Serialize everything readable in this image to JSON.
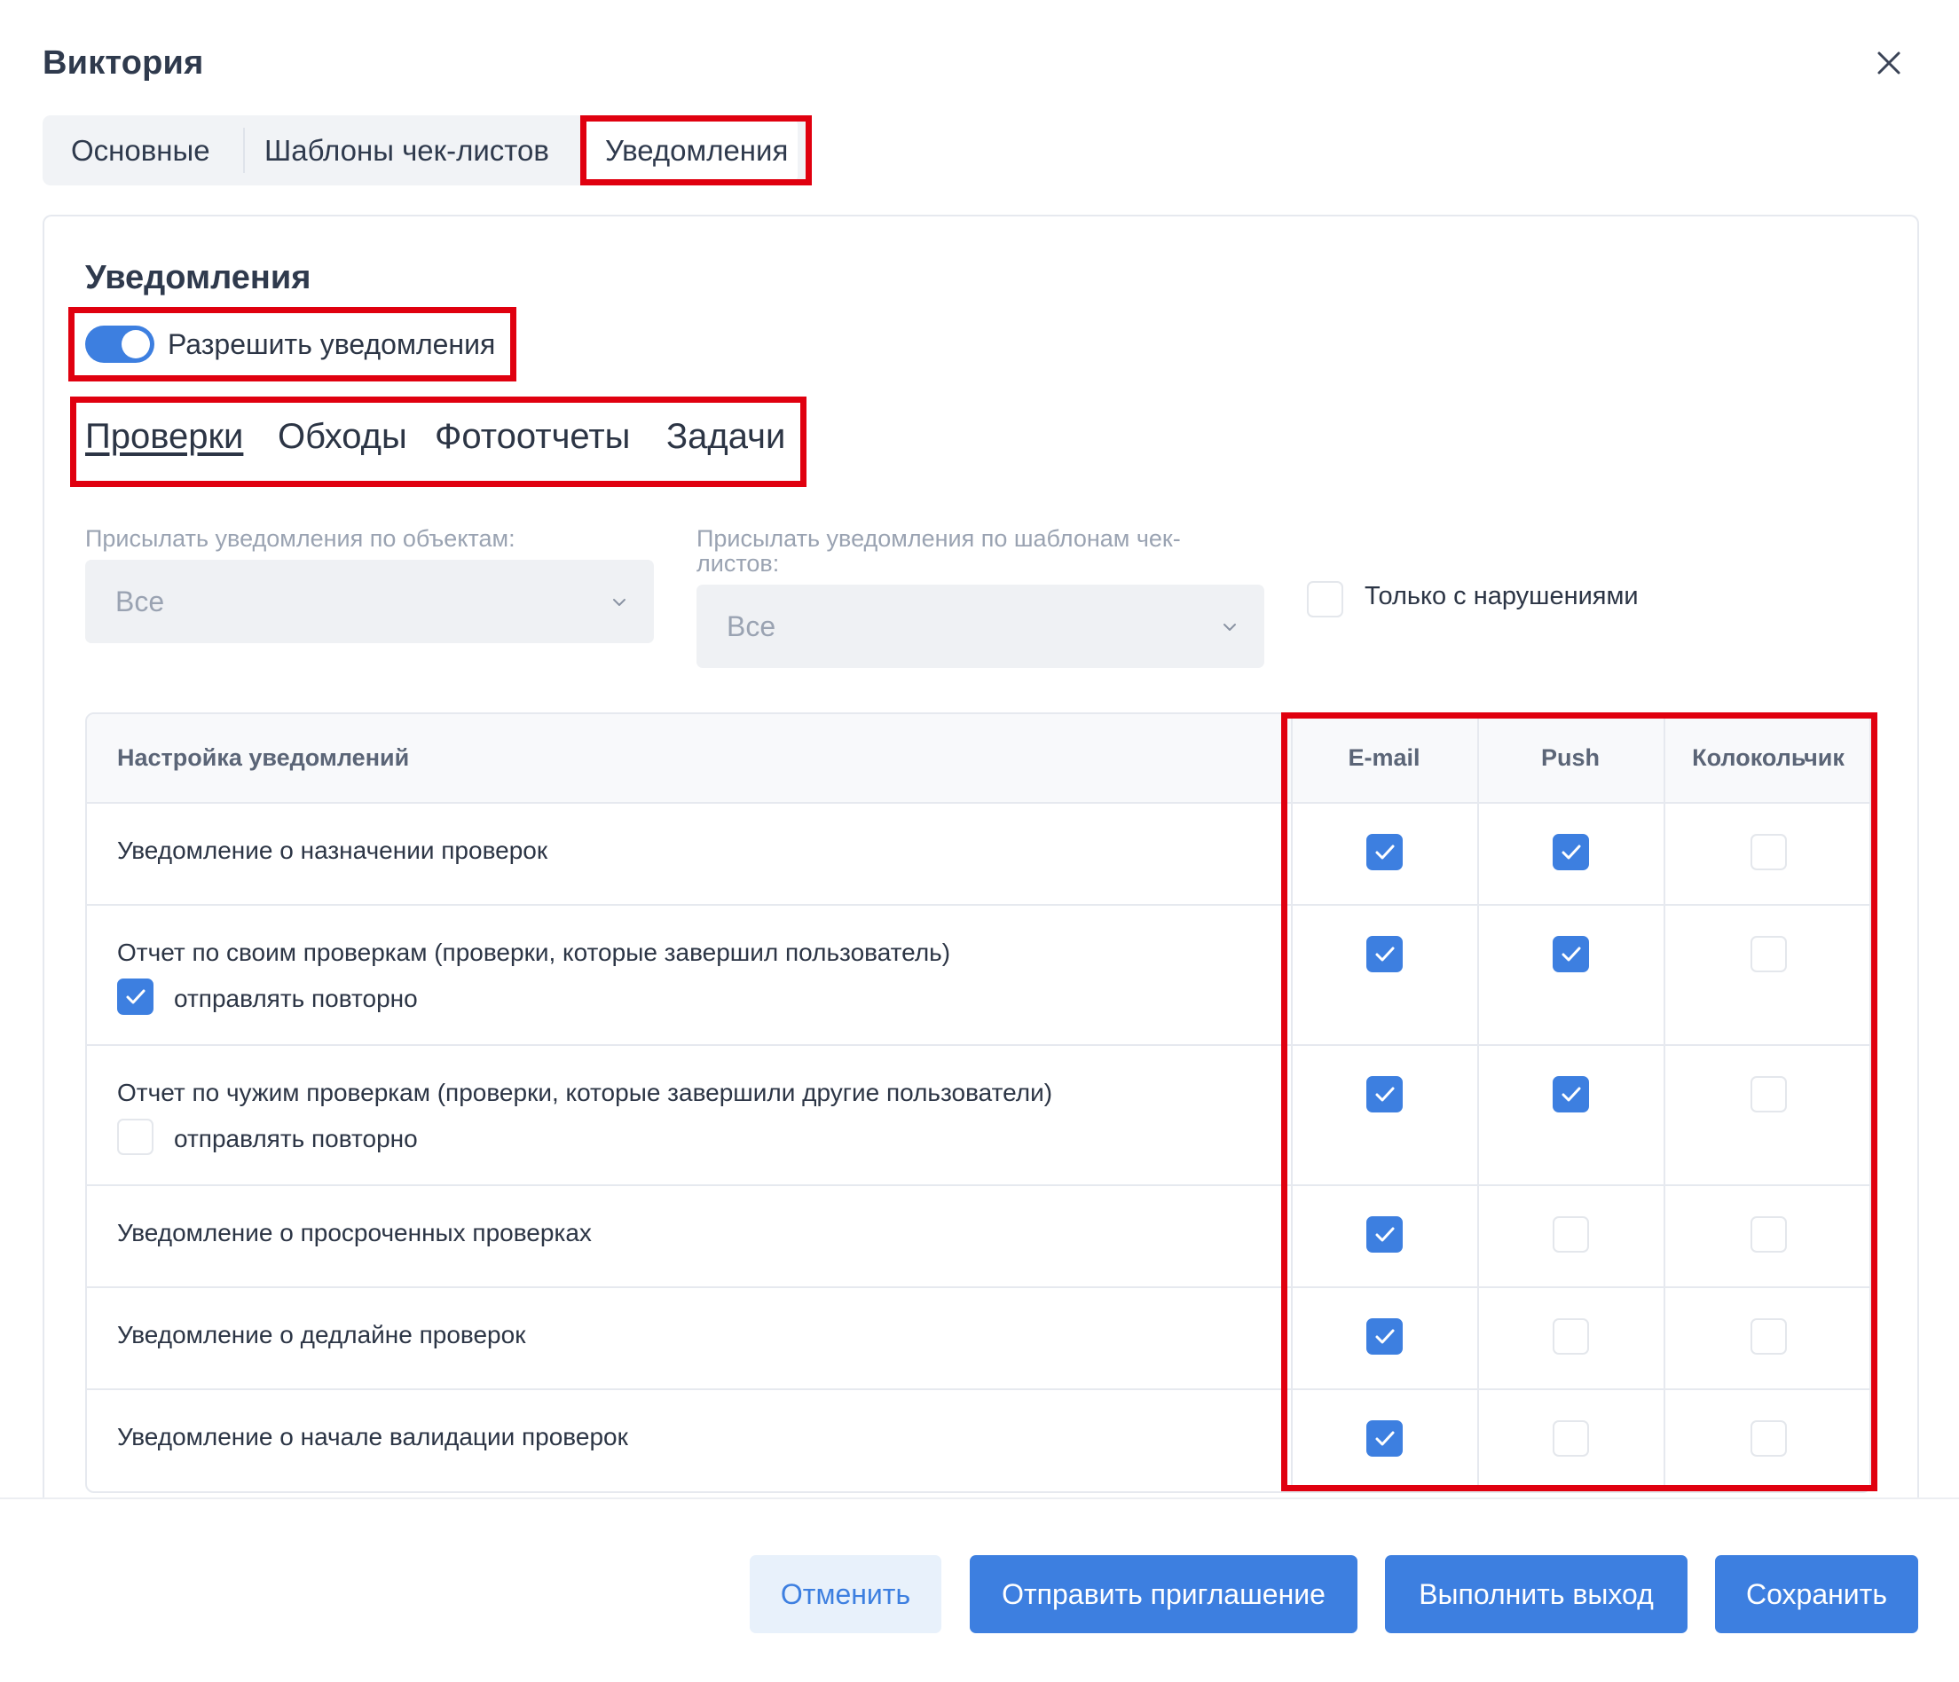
{
  "dialog": {
    "title": "Виктория",
    "close_icon": "close-icon"
  },
  "tabs": [
    {
      "label": "Основные",
      "active": false
    },
    {
      "label": "Шаблоны чек-листов",
      "active": false
    },
    {
      "label": "Уведомления",
      "active": true
    }
  ],
  "section": {
    "title": "Уведомления",
    "toggle": {
      "label": "Разрешить уведомления",
      "on": true
    }
  },
  "subtabs": [
    {
      "label": "Проверки",
      "active": true
    },
    {
      "label": "Обходы",
      "active": false
    },
    {
      "label": "Фотоотчеты",
      "active": false
    },
    {
      "label": "Задачи",
      "active": false
    }
  ],
  "filters": {
    "objects": {
      "label": "Присылать уведомления по объектам:",
      "value": "Все"
    },
    "templates": {
      "label_line1": "Присылать уведомления по шаблонам чек-",
      "label_line2": "листов:",
      "value": "Все"
    },
    "only_violations": {
      "label": "Только с нарушениями",
      "checked": false
    }
  },
  "table": {
    "headers": {
      "setting": "Настройка уведомлений",
      "email": "E-mail",
      "push": "Push",
      "bell": "Колокольчик"
    },
    "resend_label": "отправлять повторно",
    "rows": [
      {
        "label": "Уведомление о назначении проверок",
        "email": true,
        "push": true,
        "bell": false
      },
      {
        "label": "Отчет по своим проверкам (проверки, которые завершил пользователь)",
        "email": true,
        "push": true,
        "bell": false,
        "resend": true
      },
      {
        "label": "Отчет по чужим проверкам (проверки, которые завершили другие пользователи)",
        "email": true,
        "push": true,
        "bell": false,
        "resend": false
      },
      {
        "label": "Уведомление о просроченных проверках",
        "email": true,
        "push": false,
        "bell": false
      },
      {
        "label": "Уведомление о дедлайне проверок",
        "email": true,
        "push": false,
        "bell": false
      },
      {
        "label": "Уведомление о начале валидации проверок",
        "email": true,
        "push": false,
        "bell": false
      }
    ]
  },
  "footer": {
    "cancel": "Отменить",
    "invite": "Отправить приглашение",
    "logout": "Выполнить выход",
    "save": "Сохранить"
  },
  "colors": {
    "accent": "#3d7fe0",
    "highlight": "#e0000f",
    "text": "#2c3545",
    "muted": "#9aa3b2"
  }
}
